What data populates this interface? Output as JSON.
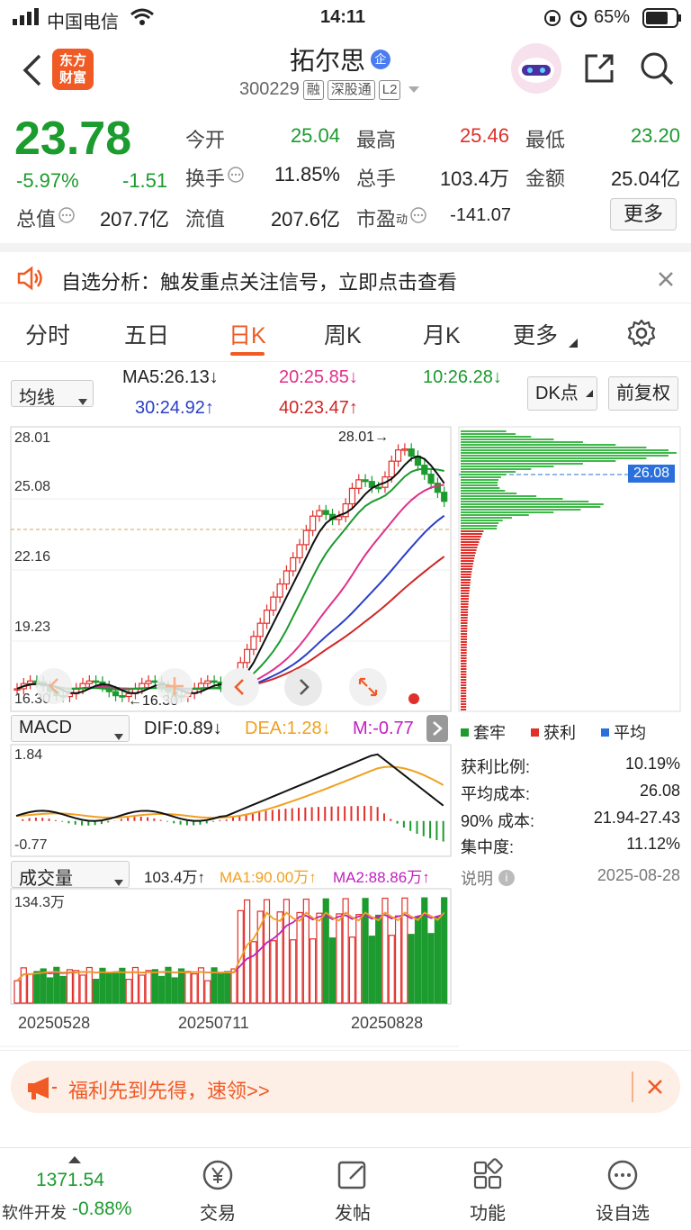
{
  "status_bar": {
    "carrier": "中国电信",
    "time": "14:11",
    "battery": "65%"
  },
  "header": {
    "logo_line1": "东方",
    "logo_line2": "财富",
    "title": "拓尔思",
    "title_badge": "企",
    "code": "300229",
    "tags": [
      "融",
      "深股通",
      "L2"
    ]
  },
  "quote": {
    "price": "23.78",
    "change_pct": "-5.97%",
    "change": "-1.51",
    "today_open_label": "今开",
    "today_open": "25.04",
    "high_label": "最高",
    "high": "25.46",
    "low_label": "最低",
    "low": "23.20",
    "turnover_label": "换手",
    "turnover": "11.85%",
    "volume_label": "总手",
    "volume": "103.4万",
    "amount_label": "金额",
    "amount": "25.04亿",
    "total_cap_label": "总值",
    "total_cap": "207.7亿",
    "float_cap_label": "流值",
    "float_cap": "207.6亿",
    "pe_label": "市盈",
    "pe_sup": "动",
    "pe": "-141.07",
    "more_button": "更多"
  },
  "notice": {
    "text": "自选分析：触发重点关注信号，立即点击查看"
  },
  "tabs": [
    "分时",
    "五日",
    "日K",
    "周K",
    "月K",
    "更多"
  ],
  "active_tab": "日K",
  "ma_panel": {
    "selector": "均线",
    "ma5": "MA5:26.13↓",
    "ma10": "10:26.28↓",
    "ma20": "20:25.85↓",
    "ma30": "30:24.92↑",
    "ma40": "40:23.47↑",
    "dk_button": "DK点",
    "adjust_button": "前复权"
  },
  "kline": {
    "y_labels": [
      "28.01",
      "25.08",
      "22.16",
      "19.23",
      "16.30"
    ],
    "high_mark": "28.01→",
    "low_mark": "←16.30",
    "cost_tag": "26.08"
  },
  "macd": {
    "selector": "MACD",
    "dif": "DIF:0.89↓",
    "dea": "DEA:1.28↓",
    "m": "M:-0.77",
    "y_top": "1.84",
    "y_bottom": "-0.77"
  },
  "chips": {
    "legend": [
      "套牢",
      "获利",
      "平均"
    ],
    "rows": [
      {
        "label": "获利比例:",
        "value": "10.19%"
      },
      {
        "label": "平均成本:",
        "value": "26.08"
      },
      {
        "label": "90% 成本:",
        "value": "21.94-27.43"
      },
      {
        "label": "集中度:",
        "value": "11.12%"
      }
    ],
    "note_label": "说明",
    "date": "2025-08-28"
  },
  "volume": {
    "selector": "成交量",
    "vol": "103.4万↑",
    "ma1": "MA1:90.00万↑",
    "ma2": "MA2:88.86万↑",
    "y_top": "134.3万",
    "dates": [
      "20250528",
      "20250711",
      "20250828"
    ]
  },
  "banner": {
    "text": "福利先到先得，速领>>"
  },
  "bottom_nav": {
    "index_value": "1371.54",
    "index_name": "软件开发",
    "index_change": "-0.88%",
    "items": [
      "交易",
      "发帖",
      "功能",
      "设自选"
    ]
  },
  "colors": {
    "up": "#e0302b",
    "down": "#1c9b2e",
    "accent": "#f05a24"
  }
}
